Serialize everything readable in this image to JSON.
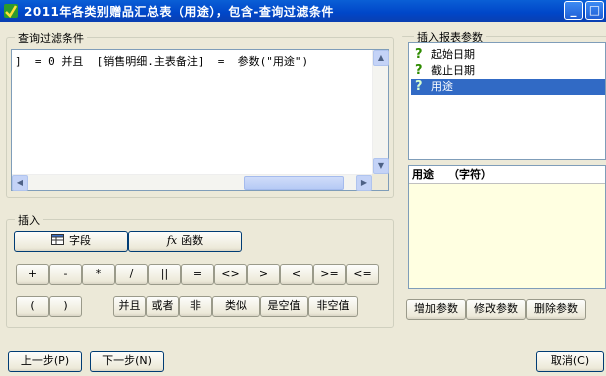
{
  "window": {
    "title": "2011年各类别赠品汇总表（用途），包含-查询过滤条件",
    "min_label": "_",
    "max_label": "□"
  },
  "filter": {
    "legend": "查询过滤条件",
    "text": "]  = 0 并且  [销售明细.主表备注]  =  参数(\"用途\")"
  },
  "insert": {
    "legend": "插入",
    "field_label": "字段",
    "function_label": "函数",
    "function_icon": "fx",
    "operators_row1": [
      "+",
      "-",
      "*",
      "/",
      "||",
      "=",
      "<>",
      ">",
      "<",
      ">=",
      "<="
    ],
    "row2": {
      "open_paren": "(",
      "close_paren": ")",
      "and": "并且",
      "or": "或者",
      "not": "非",
      "like": "类似",
      "is_null": "是空值",
      "not_null": "非空值"
    }
  },
  "params": {
    "legend": "插入报表参数",
    "items": [
      {
        "label": "起始日期"
      },
      {
        "label": "截止日期"
      },
      {
        "label": "用途",
        "selected": true
      }
    ],
    "detail_name": "用途",
    "detail_type": "（字符）",
    "add_label": "增加参数",
    "edit_label": "修改参数",
    "delete_label": "删除参数"
  },
  "footer": {
    "prev_label": "上一步(P)",
    "next_label": "下一步(N)",
    "cancel_label": "取消(C)"
  },
  "colors": {
    "titlebar": "#0046c8",
    "selection": "#316ac5",
    "detail_bg": "#ffffe1",
    "param_icon": "#2e8b00"
  }
}
